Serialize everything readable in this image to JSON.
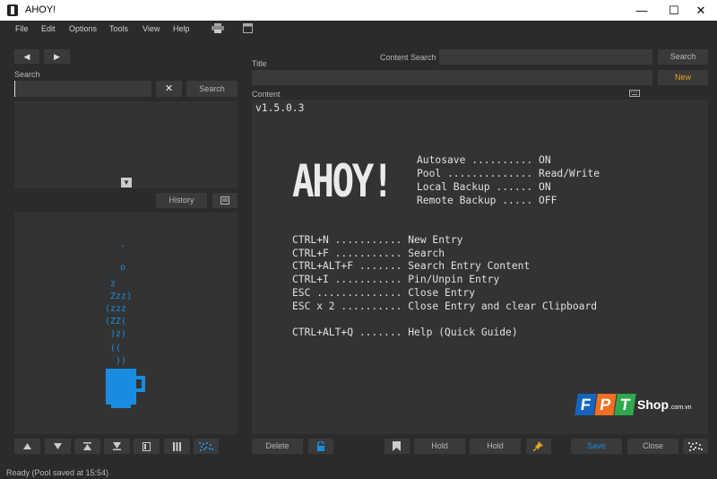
{
  "window": {
    "title": "AHOY!",
    "controls": {
      "minimize": "—",
      "maximize": "☐",
      "close": "✕"
    }
  },
  "menu": {
    "items": [
      "File",
      "Edit",
      "Options",
      "Tools",
      "View",
      "Help"
    ]
  },
  "left": {
    "search_label": "Search",
    "search_value": "",
    "clear_glyph": "✕",
    "search_button": "Search",
    "history_button": "History",
    "nav_back_glyph": "◀",
    "nav_forward_glyph": "▶",
    "collapse_glyph": "▼"
  },
  "right": {
    "title_label": "Title",
    "title_value": "",
    "content_search_label": "Content Search",
    "content_search_value": "",
    "search_button": "Search",
    "new_button": "New",
    "content_label": "Content"
  },
  "content": {
    "version": "v1.5.0.3",
    "logo_text": "AHOY!",
    "status_lines": [
      "Autosave .......... ON",
      "Pool .............. Read/Write",
      "Local Backup ...... ON",
      "Remote Backup ..... OFF"
    ],
    "shortcut_lines": [
      "CTRL+N ........... New Entry",
      "CTRL+F ........... Search",
      "CTRL+ALT+F ....... Search Entry Content",
      "CTRL+I ........... Pin/Unpin Entry",
      "ESC .............. Close Entry",
      "ESC x 2 .......... Close Entry and clear Clipboard"
    ],
    "help_line": "CTRL+ALT+Q ....... Help (Quick Guide)"
  },
  "cup_art": [
    "  .",
    "",
    "  o",
    " z",
    " Zzz)",
    "(zzz",
    "(ZZ(",
    " )z)",
    " ((",
    "  ))"
  ],
  "bottom_bar": {
    "delete_button": "Delete",
    "hold_button_1": "Hold",
    "hold_button_2": "Hold",
    "save_button": "Save",
    "close_button": "Close"
  },
  "watermark": {
    "letters": [
      "F",
      "P",
      "T"
    ],
    "shop": "Shop",
    "domain": ".com.vn"
  },
  "status": {
    "text": "Ready (Pool saved at 15:54)"
  },
  "colors": {
    "accent_orange": "#e8a020",
    "accent_blue": "#1a8ce0",
    "fpt_blue": "#1565c0",
    "fpt_orange": "#f26f21",
    "fpt_green": "#2fa84f"
  }
}
